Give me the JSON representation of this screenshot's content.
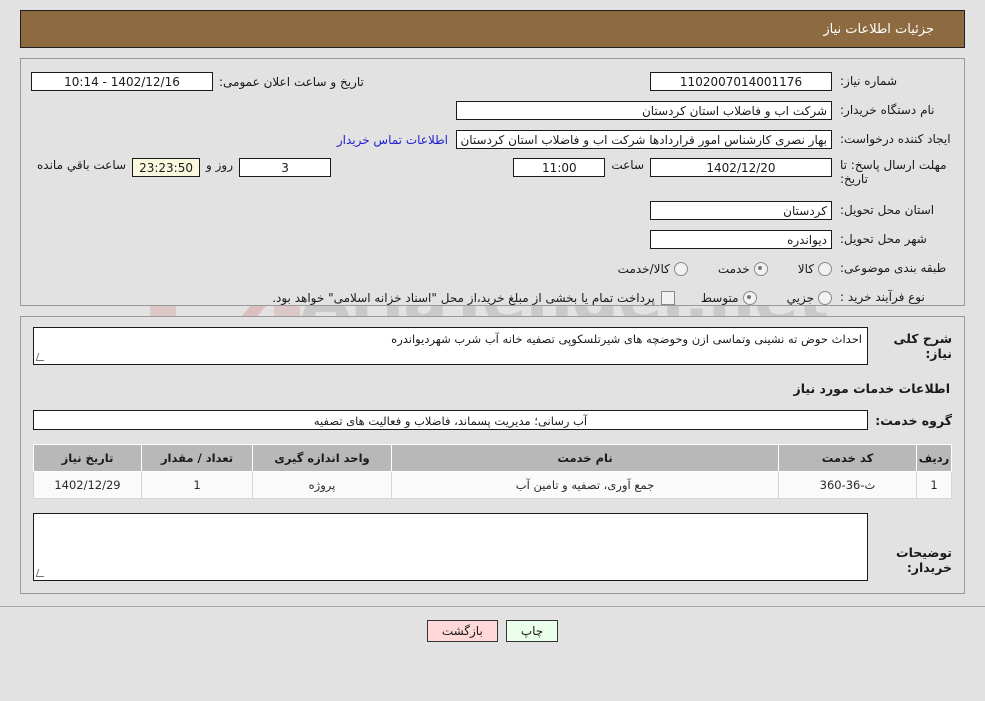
{
  "header": {
    "title": "جزئیات اطلاعات نیاز",
    "bar_color": "#8d6a3f"
  },
  "info": {
    "need_number_label": "شماره نیاز:",
    "need_number_value": "1102007014001176",
    "publish_datetime_label": "تاریخ و ساعت اعلان عمومی:",
    "publish_datetime_value": "1402/12/16 - 10:14",
    "buyer_org_label": "نام دستگاه خریدار:",
    "buyer_org_value": "شرکت اب و فاضلاب استان کردستان",
    "creator_label": "ایجاد کننده درخواست:",
    "creator_value": "بهار نصری کارشناس امور قراردادها شرکت اب و فاضلاب استان کردستان",
    "contact_link": "اطلاعات تماس خریدار",
    "deadline_label": "مهلت ارسال پاسخ: تا تاریخ:",
    "deadline_value": "1402/12/20",
    "hour_label": "ساعت",
    "hour_value": "11:00",
    "days_value": "3",
    "days_label": "روز و",
    "remaining_value": "23:23:50",
    "remaining_label": "ساعت باقي مانده",
    "province_label": "استان محل تحویل:",
    "province_value": "کردستان",
    "city_label": "شهر محل تحویل:",
    "city_value": "دیواندره",
    "category_label": "طبقه بندی موضوعی:",
    "category_options": [
      {
        "label": "کالا",
        "selected": false
      },
      {
        "label": "خدمت",
        "selected": true
      },
      {
        "label": "کالا/خدمت",
        "selected": false
      }
    ],
    "process_label": "نوع فرآیند خرید :",
    "process_options": [
      {
        "label": "جزیي",
        "selected": false
      },
      {
        "label": "متوسط",
        "selected": true
      }
    ],
    "treasury_checkbox_label": "پرداخت تمام یا بخشی از مبلغ خرید،از محل \"اسناد خزانه اسلامی\" خواهد بود.",
    "treasury_checkbox_checked": false
  },
  "need": {
    "summary_label": "شرح کلی نیاز:",
    "summary_value": "احداث حوض ته نشینی وتماسی ازن وحوضچه های شیرتلسکوپی تصفیه خانه آب شرب شهردیواندره",
    "services_section_title": "اطلاعات خدمات مورد نیاز",
    "service_group_label": "گروه خدمت:",
    "service_group_value": "آب رسانی؛ مدیریت پسماند، فاضلاب و فعالیت های تصفیه"
  },
  "table": {
    "columns": [
      "ردیف",
      "کد خدمت",
      "نام خدمت",
      "واحد اندازه گیری",
      "تعداد / مقدار",
      "تاریخ نیاز"
    ],
    "rows": [
      {
        "radif": "1",
        "code": "ث-36-360",
        "name": "جمع آوری، تصفیه و تامین آب",
        "unit": "پروژه",
        "qty": "1",
        "date": "1402/12/29"
      }
    ]
  },
  "notes": {
    "label": "توضیحات خریدار:",
    "value": ""
  },
  "footer": {
    "back_label": "بازگشت",
    "print_label": "چاپ"
  },
  "watermark": {
    "text": "AriaTender.net",
    "mark": "V"
  }
}
